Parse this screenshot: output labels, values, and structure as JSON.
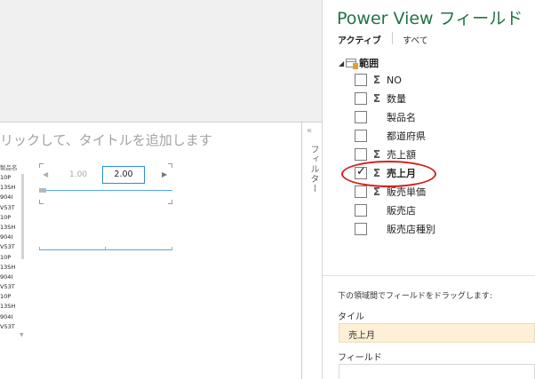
{
  "canvas": {
    "title_placeholder": "リックして、タイトルを追加します",
    "table": {
      "header": "製品名",
      "rows": [
        "10P",
        "13SH",
        "904I",
        "V53T",
        "10P",
        "13SH",
        "904I",
        "V53T",
        "10P",
        "13SH",
        "904I",
        "V53T",
        "10P",
        "13SH",
        "904I",
        "V53T"
      ]
    },
    "slicer": {
      "prev_value": "1.00",
      "current_value": "2.00"
    },
    "filter_label": "フィルター"
  },
  "field_list": {
    "title": "Power View フィールド",
    "tabs": {
      "active": "アクティブ",
      "all": "すべて"
    },
    "table_name": "範囲",
    "fields": [
      {
        "label": "NO",
        "sigma": true,
        "checked": false
      },
      {
        "label": "数量",
        "sigma": true,
        "checked": false
      },
      {
        "label": "製品名",
        "sigma": false,
        "checked": false
      },
      {
        "label": "都道府県",
        "sigma": false,
        "checked": false
      },
      {
        "label": "売上額",
        "sigma": true,
        "checked": false
      },
      {
        "label": "売上月",
        "sigma": true,
        "checked": true
      },
      {
        "label": "販売単価",
        "sigma": true,
        "checked": false
      },
      {
        "label": "販売店",
        "sigma": false,
        "checked": false
      },
      {
        "label": "販売店種別",
        "sigma": false,
        "checked": false
      }
    ],
    "drag_instruction": "下の領域間でフィールドをドラッグします:",
    "tile_label": "タイル",
    "tile_value": "売上月",
    "field_area_label": "フィールド"
  },
  "colors": {
    "title_green": "#217346",
    "highlight_red": "#d22020",
    "slicer_blue": "#2a8fd4",
    "tile_bg": "#fdf0d6"
  }
}
